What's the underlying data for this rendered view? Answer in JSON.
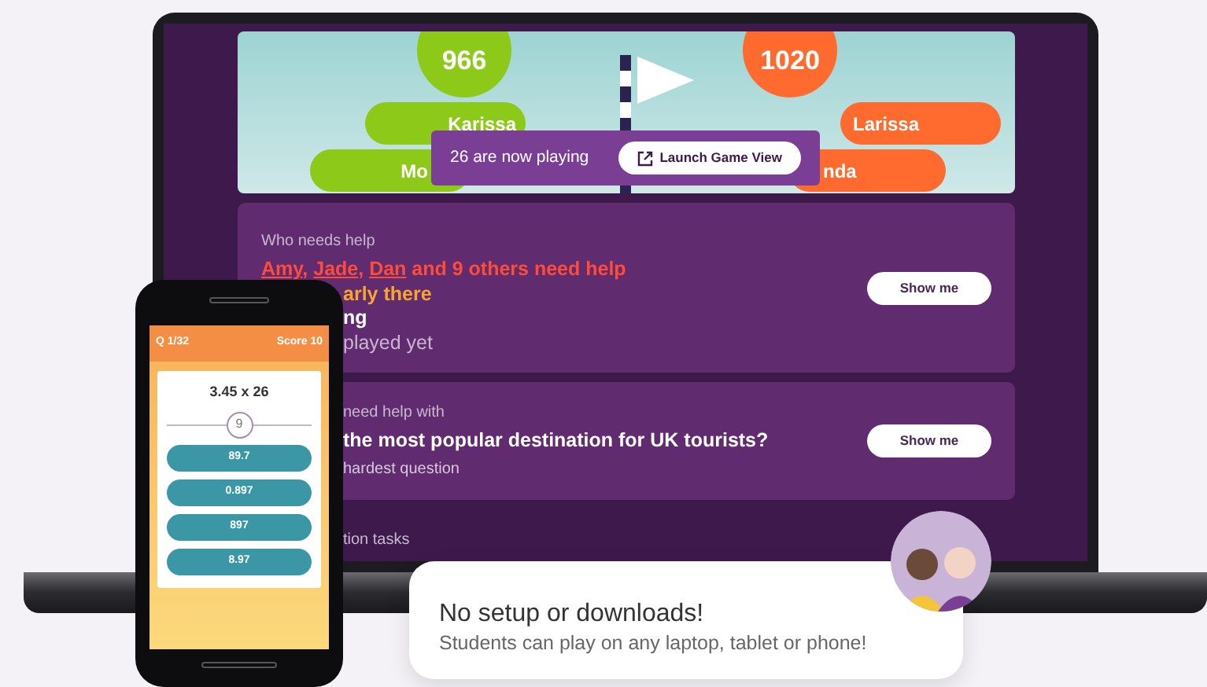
{
  "game": {
    "teams": [
      {
        "score": "966",
        "color": "#8dc918",
        "players": [
          "Karissa",
          "Mo"
        ]
      },
      {
        "score": "1020",
        "color": "#ff6a2f",
        "players": [
          "Larissa",
          "nda"
        ]
      }
    ],
    "status": "26 are now playing",
    "launch_button": "Launch Game View"
  },
  "help_cards": [
    {
      "heading": "Who needs help",
      "button": "Show me",
      "lines": [
        {
          "color": "#ff4b3a",
          "parts": [
            {
              "text": "Amy",
              "link": true
            },
            {
              "text": ", ",
              "link": false
            },
            {
              "text": "Jade",
              "link": true
            },
            {
              "text": ", ",
              "link": false
            },
            {
              "text": "Dan",
              "link": true
            },
            {
              "text": " and 9 others need help",
              "link": false
            }
          ]
        },
        {
          "color": "#f7a531",
          "parts": [
            {
              "text": "arly there",
              "link": false
            }
          ]
        },
        {
          "color": "#ffffff",
          "parts": [
            {
              "text": "ng",
              "link": false
            }
          ]
        },
        {
          "color": "#c9b6cf",
          "parts": [
            {
              "text": "played yet",
              "link": false
            }
          ]
        }
      ]
    },
    {
      "heading": "need help with",
      "button": "Show me",
      "question": "the most popular destination for UK tourists?",
      "note": "hardest question"
    }
  ],
  "tasks_heading": "tion tasks",
  "phone": {
    "question_number": "Q 1/32",
    "score": "Score 10",
    "question": "3.45 x 26",
    "timer": "9",
    "answers": [
      "89.7",
      "0.897",
      "897",
      "8.97"
    ]
  },
  "bubble": {
    "title": "No setup or downloads!",
    "subtitle": "Students can play on any laptop, tablet or phone!"
  }
}
